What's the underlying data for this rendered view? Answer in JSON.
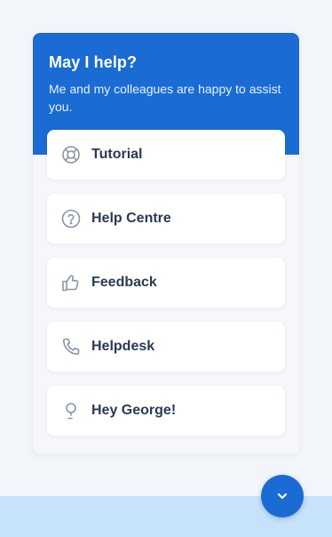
{
  "header": {
    "title": "May I help?",
    "subtitle": "Me and my colleagues are happy to assist you."
  },
  "menu": {
    "items": [
      {
        "label": "Tutorial",
        "icon": "lifebuoy-icon"
      },
      {
        "label": "Help Centre",
        "icon": "question-circle-icon"
      },
      {
        "label": "Feedback",
        "icon": "thumbs-up-icon"
      },
      {
        "label": "Helpdesk",
        "icon": "phone-icon"
      },
      {
        "label": "Hey George!",
        "icon": "assistant-icon"
      }
    ]
  },
  "fab": {
    "icon": "chevron-down-icon"
  },
  "colors": {
    "primary": "#1a6bd3",
    "background": "#f2f5f9",
    "card": "#ffffff",
    "label": "#2b3a52",
    "icon": "#8a94a6",
    "bottom_band": "#c6e3fb"
  }
}
